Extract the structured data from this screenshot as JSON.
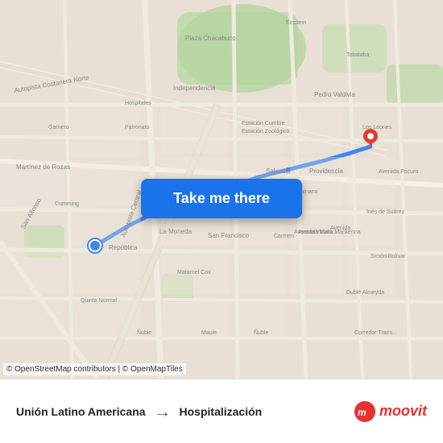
{
  "map": {
    "attribution": "© OpenStreetMap contributors | © OpenMapTiles",
    "origin_label": "Unión Latino Americana",
    "destination_label": "Hospitalización",
    "button_label": "Take me there"
  },
  "branding": {
    "logo_text": "moovit"
  },
  "route": {
    "arrow": "→"
  }
}
